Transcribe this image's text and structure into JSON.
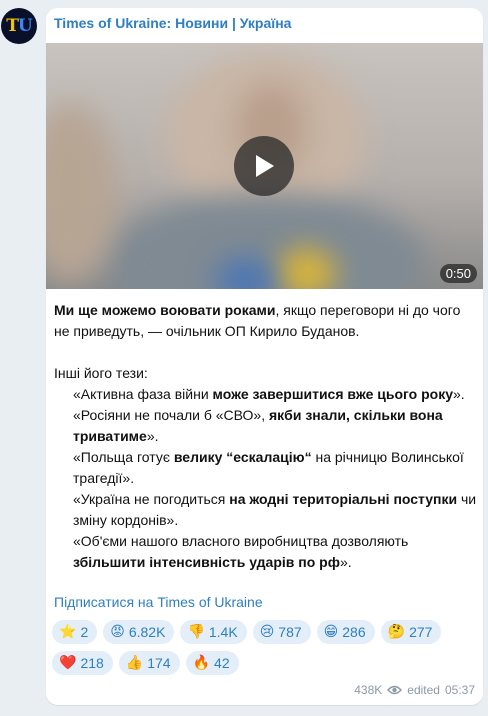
{
  "channel": {
    "avatar_letters": [
      "T",
      "U"
    ],
    "title": "Times of Ukraine: Новини | Україна"
  },
  "video": {
    "duration": "0:50",
    "play_icon": "play-icon"
  },
  "post": {
    "lines": [
      [
        {
          "t": "Ми ще можемо воювати роками",
          "b": true
        },
        {
          "t": ", якщо переговори ні до чого не приведуть, — очільник ОП Кирило Буданов."
        }
      ],
      [],
      [
        {
          "t": "Інші його тези:"
        }
      ],
      [
        {
          "t": "«Активна фаза війни "
        },
        {
          "t": "може завершитися вже цього року",
          "b": true
        },
        {
          "t": "»."
        }
      ],
      [
        {
          "t": "«Росіяни не почали б «СВО», "
        },
        {
          "t": "якби знали, скільки вона триватиме",
          "b": true
        },
        {
          "t": "»."
        }
      ],
      [
        {
          "t": "«Польща готує "
        },
        {
          "t": "велику “ескалацію“",
          "b": true
        },
        {
          "t": " на річницю Волинської трагедії»."
        }
      ],
      [
        {
          "t": "«Україна не погодиться "
        },
        {
          "t": "на жодні територіальні поступки",
          "b": true
        },
        {
          "t": " чи зміну кордонів»."
        }
      ],
      [
        {
          "t": "«Об'єми нашого власного виробництва дозволяють "
        },
        {
          "t": "збільшити інтенсивність ударів по рф",
          "b": true
        },
        {
          "t": "»."
        }
      ]
    ],
    "indented": [
      false,
      false,
      false,
      true,
      true,
      true,
      true,
      true
    ],
    "subscribe_link": "Підписатися на Times of Ukraine"
  },
  "reactions": [
    {
      "icon": "star-icon",
      "emoji": "⭐",
      "count": "2"
    },
    {
      "icon": "angry-face-icon",
      "emoji": "😡",
      "count": "6.82K"
    },
    {
      "icon": "thumbs-down-icon",
      "emoji": "👎",
      "count": "1.4K"
    },
    {
      "icon": "crying-face-icon",
      "emoji": "😢",
      "count": "787"
    },
    {
      "icon": "grinning-face-icon",
      "emoji": "😁",
      "count": "286"
    },
    {
      "icon": "thinking-face-icon",
      "emoji": "🤔",
      "count": "277"
    },
    {
      "icon": "heart-icon",
      "emoji": "❤️",
      "count": "218"
    },
    {
      "icon": "thumbs-up-icon",
      "emoji": "👍",
      "count": "174"
    },
    {
      "icon": "fire-icon",
      "emoji": "🔥",
      "count": "42"
    }
  ],
  "meta": {
    "views": "438K",
    "views_icon": "eye-icon",
    "edited_label": "edited",
    "time": "05:37"
  },
  "colors": {
    "accent": "#2f7fc0",
    "reaction_bg": "#e3eef8",
    "page_bg": "#e9eef2",
    "meta_text": "#8a9aa8"
  }
}
